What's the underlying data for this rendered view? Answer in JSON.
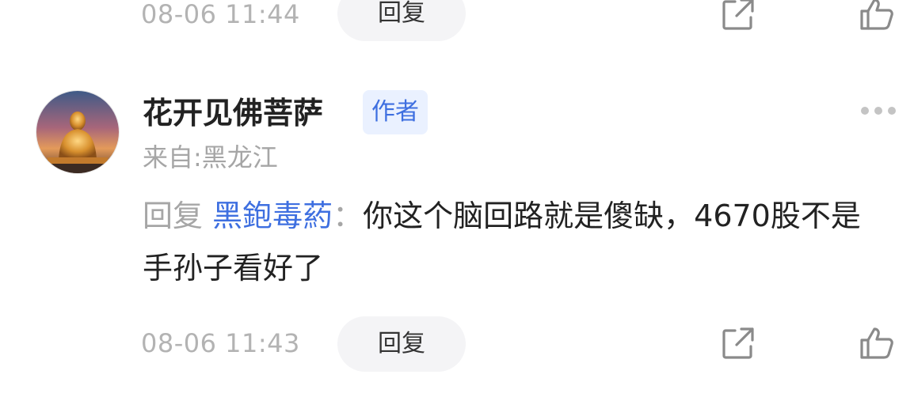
{
  "previous_comment": {
    "timestamp": "08-06 11:44",
    "reply_label": "回复"
  },
  "comment": {
    "username": "花开见佛菩萨",
    "author_badge": "作者",
    "location": "来自:黑龙江",
    "reply_prefix": "回复",
    "reply_to": "黑鉋毒葯",
    "colon": "：",
    "text": "你这个脑回路就是傻缺，4670股不是手孙子看好了",
    "timestamp": "08-06 11:43",
    "reply_label": "回复"
  },
  "icons": {
    "share": "share-icon",
    "like": "thumbs-up-icon",
    "more": "more-horizontal-icon"
  },
  "colors": {
    "accent_blue": "#3e6fe0",
    "badge_bg": "#eaf1ff",
    "muted_text": "#a6a6a6",
    "pill_bg": "#f4f4f6"
  }
}
